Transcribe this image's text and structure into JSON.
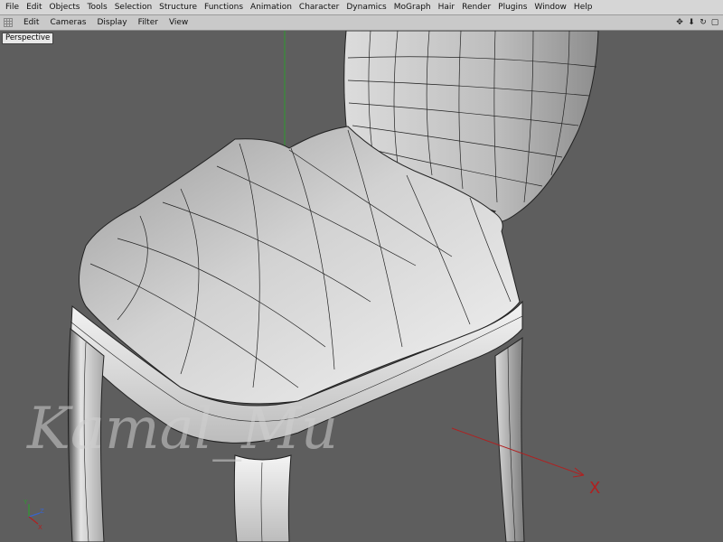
{
  "menubar": {
    "items": [
      "File",
      "Edit",
      "Objects",
      "Tools",
      "Selection",
      "Structure",
      "Functions",
      "Animation",
      "Character",
      "Dynamics",
      "MoGraph",
      "Hair",
      "Render",
      "Plugins",
      "Window",
      "Help"
    ]
  },
  "viewport_menu": {
    "items": [
      "Edit",
      "Cameras",
      "Display",
      "Filter",
      "View"
    ]
  },
  "viewport": {
    "label": "Perspective",
    "watermark": "Kamal_Mu",
    "axis_labels": {
      "y": "Y",
      "z": "Z",
      "x": "X"
    }
  },
  "colors": {
    "background": "#5e5e5e",
    "y_axis": "#2f9a2f",
    "x_axis": "#b02020",
    "wire": "#1a1a1a"
  },
  "icons": [
    "move-view-icon",
    "zoom-view-icon",
    "rotate-view-icon",
    "maximize-view-icon"
  ]
}
